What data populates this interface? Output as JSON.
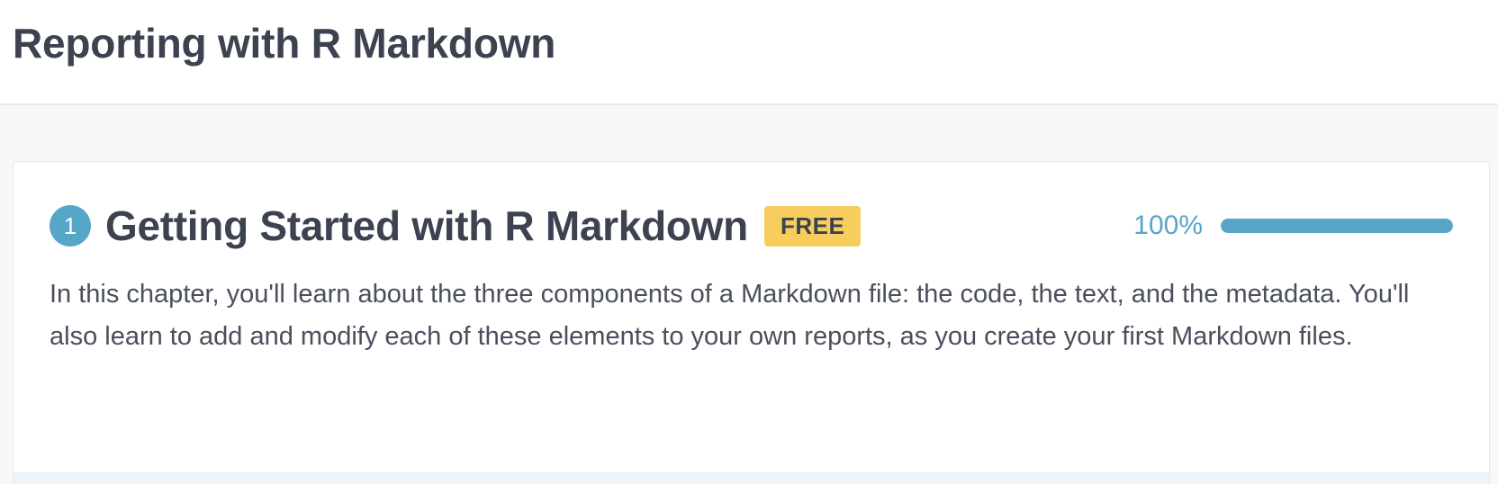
{
  "course": {
    "title": "Reporting with R Markdown"
  },
  "chapter": {
    "number": "1",
    "title": "Getting Started with R Markdown",
    "badge": "FREE",
    "progress_label": "100%",
    "progress_value": 1.0,
    "description": "In this chapter, you'll learn about the three components of a Markdown file: the code, the text, and the metadata. You'll also learn to add and modify each of these elements to your own reports, as you create your first Markdown files."
  },
  "colors": {
    "accent": "#56a6c8",
    "badge": "#f7cd5e",
    "text": "#3d4251"
  }
}
